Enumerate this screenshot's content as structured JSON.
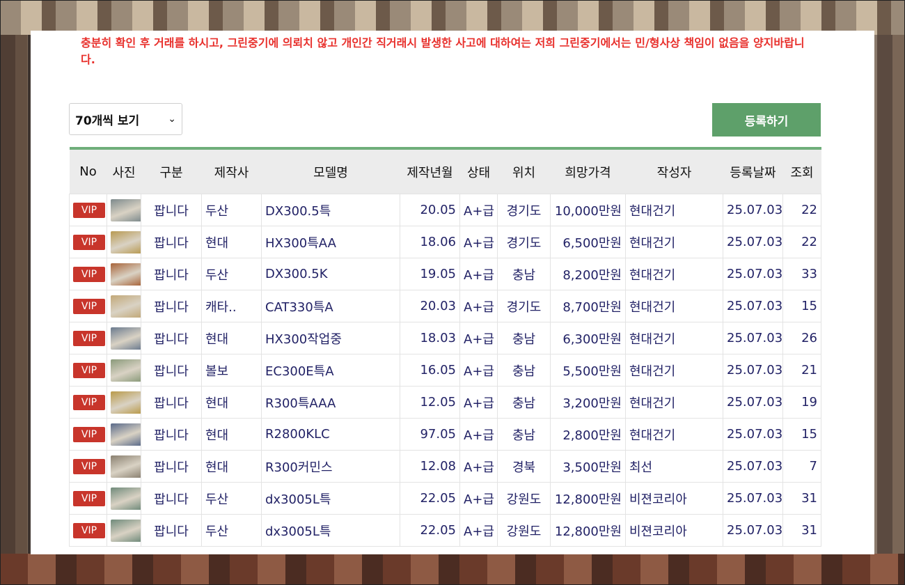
{
  "notice": "충분히 확인 후 거래를 하시고, 그린중기에 의뢰치 않고 개인간 직거래시 발생한 사고에 대하여는 저희 그린중기에서는 민/형사상 책임이 없음을 양지바랍니다.",
  "toolbar": {
    "page_size_label": "70개씩 보기",
    "register_label": "등록하기"
  },
  "colors": {
    "notice": "#e8302c",
    "register_button": "#5ea06a",
    "table_top_border": "#6fae7a",
    "vip_badge": "#c8352b",
    "cell_text": "#222266"
  },
  "table": {
    "headers": [
      "No",
      "사진",
      "구분",
      "제작사",
      "모델명",
      "제작년월",
      "상태",
      "위치",
      "희망가격",
      "작성자",
      "등록날짜",
      "조회"
    ],
    "rows": [
      {
        "badge": "VIP",
        "thumb": "excavator-photo",
        "type": "팝니다",
        "maker": "두산",
        "model": "DX300.5특",
        "year": "20.05",
        "grade": "A+급",
        "location": "경기도",
        "price": "10,000만원",
        "author": "현대건기",
        "date": "25.07.03",
        "views": "22",
        "thumb_color": "#7d8a8c"
      },
      {
        "badge": "VIP",
        "thumb": "excavator-photo",
        "type": "팝니다",
        "maker": "현대",
        "model": "HX300특AA",
        "year": "18.06",
        "grade": "A+급",
        "location": "경기도",
        "price": "6,500만원",
        "author": "현대건기",
        "date": "25.07.03",
        "views": "22",
        "thumb_color": "#b89a52"
      },
      {
        "badge": "VIP",
        "thumb": "excavator-photo",
        "type": "팝니다",
        "maker": "두산",
        "model": "DX300.5K",
        "year": "19.05",
        "grade": "A+급",
        "location": "충남",
        "price": "8,200만원",
        "author": "현대건기",
        "date": "25.07.03",
        "views": "33",
        "thumb_color": "#a8643a"
      },
      {
        "badge": "VIP",
        "thumb": "excavator-photo",
        "type": "팝니다",
        "maker": "캐타..",
        "model": "CAT330특A",
        "year": "20.03",
        "grade": "A+급",
        "location": "경기도",
        "price": "8,700만원",
        "author": "현대건기",
        "date": "25.07.03",
        "views": "15",
        "thumb_color": "#c2a878"
      },
      {
        "badge": "VIP",
        "thumb": "excavator-photo",
        "type": "팝니다",
        "maker": "현대",
        "model": "HX300작업중",
        "year": "18.03",
        "grade": "A+급",
        "location": "충남",
        "price": "6,300만원",
        "author": "현대건기",
        "date": "25.07.03",
        "views": "26",
        "thumb_color": "#6a7a8e"
      },
      {
        "badge": "VIP",
        "thumb": "excavator-photo",
        "type": "팝니다",
        "maker": "볼보",
        "model": "EC300E특A",
        "year": "16.05",
        "grade": "A+급",
        "location": "충남",
        "price": "5,500만원",
        "author": "현대건기",
        "date": "25.07.03",
        "views": "21",
        "thumb_color": "#8a9a7a"
      },
      {
        "badge": "VIP",
        "thumb": "excavator-photo",
        "type": "팝니다",
        "maker": "현대",
        "model": "R300특AAA",
        "year": "12.05",
        "grade": "A+급",
        "location": "충남",
        "price": "3,200만원",
        "author": "현대건기",
        "date": "25.07.03",
        "views": "19",
        "thumb_color": "#b99a4a"
      },
      {
        "badge": "VIP",
        "thumb": "excavator-photo",
        "type": "팝니다",
        "maker": "현대",
        "model": "R2800KLC",
        "year": "97.05",
        "grade": "A+급",
        "location": "충남",
        "price": "2,800만원",
        "author": "현대건기",
        "date": "25.07.03",
        "views": "15",
        "thumb_color": "#5a6a8a"
      },
      {
        "badge": "VIP",
        "thumb": "excavator-photo",
        "type": "팝니다",
        "maker": "현대",
        "model": "R300커민스",
        "year": "12.08",
        "grade": "A+급",
        "location": "경북",
        "price": "3,500만원",
        "author": "최선",
        "date": "25.07.03",
        "views": "7",
        "thumb_color": "#8a8070"
      },
      {
        "badge": "VIP",
        "thumb": "excavator-photo",
        "type": "팝니다",
        "maker": "두산",
        "model": "dx3005L특",
        "year": "22.05",
        "grade": "A+급",
        "location": "강원도",
        "price": "12,800만원",
        "author": "비젼코리아",
        "date": "25.07.03",
        "views": "31",
        "thumb_color": "#6f8a7a"
      },
      {
        "badge": "VIP",
        "thumb": "excavator-photo",
        "type": "팝니다",
        "maker": "두산",
        "model": "dx3005L특",
        "year": "22.05",
        "grade": "A+급",
        "location": "강원도",
        "price": "12,800만원",
        "author": "비젼코리아",
        "date": "25.07.03",
        "views": "31",
        "thumb_color": "#6f8a7a"
      }
    ]
  }
}
